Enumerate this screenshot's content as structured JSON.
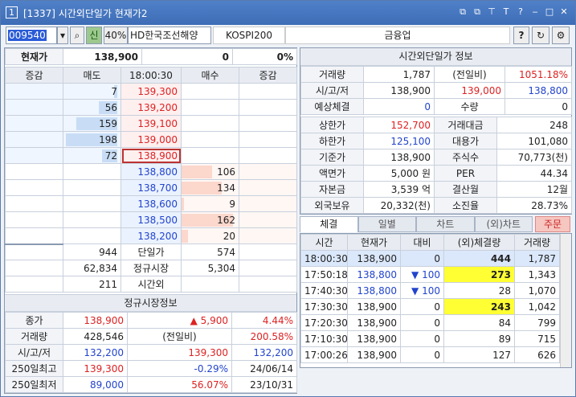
{
  "title": {
    "num": "1",
    "text": "[1337] 시간외단일가 현재가2",
    "controls": [
      "⧉",
      "⧉",
      "⊤",
      "T",
      "?",
      "‒",
      "□",
      "✕"
    ]
  },
  "toolbar": {
    "code": "009540",
    "badge": "신",
    "margin": "40%",
    "stock": "HD한국조선해양",
    "market": "KOSPI200",
    "sector": "금융업",
    "q": "?"
  },
  "summary": {
    "label": "현재가",
    "price": "138,900",
    "change": "0",
    "rate": "0%"
  },
  "ob_header": [
    "증감",
    "매도",
    "18:00:30",
    "매수",
    "증감"
  ],
  "asks": [
    {
      "qty": "7",
      "price": "139,300",
      "pct": 7
    },
    {
      "qty": "56",
      "price": "139,200",
      "pct": 36
    },
    {
      "qty": "159",
      "price": "139,100",
      "pct": 80
    },
    {
      "qty": "198",
      "price": "139,000",
      "pct": 100
    },
    {
      "qty": "72",
      "price": "138,900",
      "pct": 30
    }
  ],
  "bids": [
    {
      "price": "138,800",
      "qty": "106",
      "pct": 60
    },
    {
      "price": "138,700",
      "qty": "134",
      "pct": 78
    },
    {
      "price": "138,600",
      "qty": "9",
      "pct": 5
    },
    {
      "price": "138,500",
      "qty": "162",
      "pct": 100
    },
    {
      "price": "138,200",
      "qty": "20",
      "pct": 12
    }
  ],
  "ob_footer": [
    {
      "l": "944",
      "m": "단일가",
      "r": "574"
    },
    {
      "l": "62,834",
      "m": "정규시장",
      "r": "5,304"
    },
    {
      "l": "211",
      "m": "시간외",
      "r": ""
    }
  ],
  "regular": {
    "title": "정규시장정보",
    "rows": [
      {
        "a": "종가",
        "b": "138,900",
        "c": "▲ 5,900",
        "d": "4.44%"
      },
      {
        "a": "거래량",
        "b": "428,546",
        "c": "(전일비)",
        "d": "200.58%"
      },
      {
        "a": "시/고/저",
        "b": "132,200",
        "c": "139,300",
        "d": "132,200"
      },
      {
        "a": "250일최고",
        "b": "139,300",
        "c": "-0.29%",
        "d": "24/06/14"
      },
      {
        "a": "250일최저",
        "b": "89,000",
        "c": "56.07%",
        "d": "23/10/31"
      }
    ]
  },
  "info": {
    "title": "시간외단일가 정보",
    "r1": {
      "l": "거래량",
      "v": "1,787",
      "m": "(전일비)",
      "x": "1051.18%"
    },
    "r2": {
      "l": "시/고/저",
      "a": "138,900",
      "b": "139,000",
      "c": "138,800"
    },
    "r3": {
      "l": "예상체결",
      "v": "0",
      "m": "수량",
      "x": "0"
    },
    "grid": [
      [
        "상한가",
        "152,700",
        "거래대금",
        "248"
      ],
      [
        "하한가",
        "125,100",
        "대용가",
        "101,080"
      ],
      [
        "기준가",
        "138,900",
        "주식수",
        "70,773(천)"
      ],
      [
        "액면가",
        "5,000 원",
        "PER",
        "44.34"
      ],
      [
        "자본금",
        "3,539 억",
        "결산월",
        "12월"
      ],
      [
        "외국보유",
        "20,332(천)",
        "소진율",
        "28.73%"
      ]
    ]
  },
  "tabs": [
    "체결",
    "일별",
    "차트",
    "(외)차트"
  ],
  "order": "주문",
  "trades": {
    "header": [
      "시간",
      "현재가",
      "대비",
      "(외)체결량",
      "거래량"
    ],
    "rows": [
      {
        "t": "18:00:30",
        "p": "138,900",
        "d": "0",
        "q": "444",
        "v": "1,787"
      },
      {
        "t": "17:50:18",
        "p": "138,800",
        "d": "▼ 100",
        "q": "273",
        "v": "1,343"
      },
      {
        "t": "17:40:30",
        "p": "138,800",
        "d": "▼ 100",
        "q": "28",
        "v": "1,070"
      },
      {
        "t": "17:30:30",
        "p": "138,900",
        "d": "0",
        "q": "243",
        "v": "1,042"
      },
      {
        "t": "17:20:30",
        "p": "138,900",
        "d": "0",
        "q": "84",
        "v": "799"
      },
      {
        "t": "17:10:30",
        "p": "138,900",
        "d": "0",
        "q": "89",
        "v": "715"
      },
      {
        "t": "17:00:26",
        "p": "138,900",
        "d": "0",
        "q": "127",
        "v": "626"
      }
    ]
  }
}
